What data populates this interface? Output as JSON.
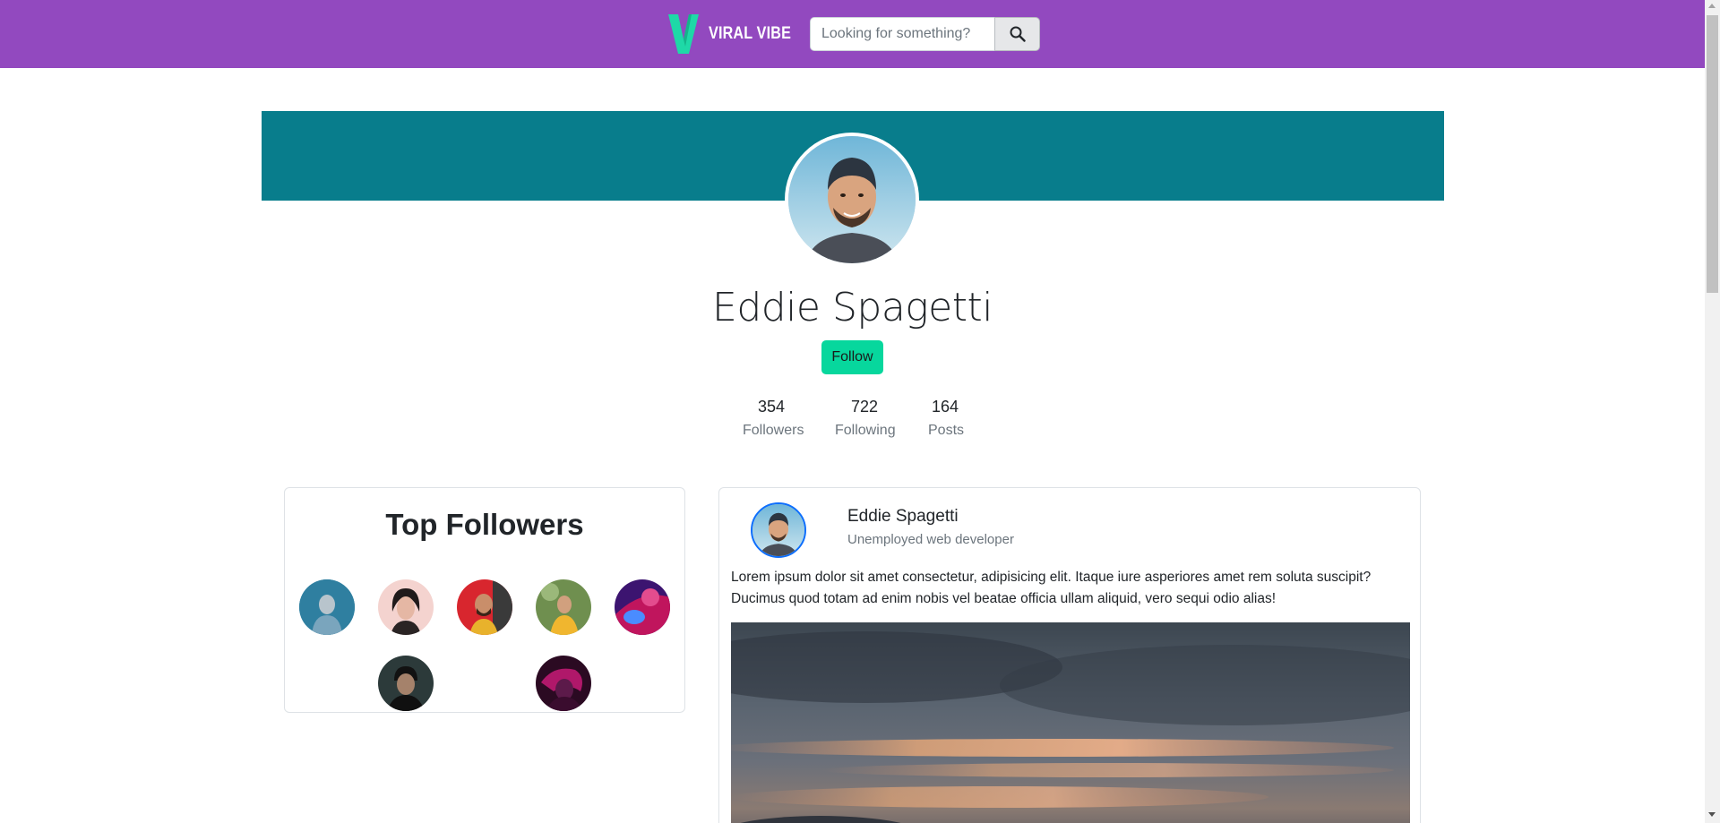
{
  "nav": {
    "brand_name": "VIRAL VIBE",
    "brand_mark": "V",
    "search_placeholder": "Looking for something?",
    "search_icon": "search-icon"
  },
  "profile": {
    "name": "Eddie Spagetti",
    "follow_label": "Follow",
    "cover_color": "#087d8c",
    "stats": [
      {
        "value": "354",
        "label": "Followers"
      },
      {
        "value": "722",
        "label": "Following"
      },
      {
        "value": "164",
        "label": "Posts"
      }
    ]
  },
  "top_followers": {
    "title": "Top Followers",
    "avatars": [
      {
        "name": "follower-avatar-1"
      },
      {
        "name": "follower-avatar-2"
      },
      {
        "name": "follower-avatar-3"
      },
      {
        "name": "follower-avatar-4"
      },
      {
        "name": "follower-avatar-5"
      },
      {
        "name": "follower-avatar-6"
      },
      {
        "name": "follower-avatar-7"
      }
    ]
  },
  "post": {
    "author": "Eddie Spagetti",
    "subtitle": "Unemployed web developer",
    "body": "Lorem ipsum dolor sit amet consectetur, adipisicing elit. Itaque iure asperiores amet rem soluta suscipit? Ducimus quod totam ad enim nobis vel beatae officia ullam aliquid, vero sequi odio alias!"
  },
  "colors": {
    "navbar": "#9249bf",
    "accent": "#07d79d",
    "brand_mark": "#1ed9a7"
  }
}
